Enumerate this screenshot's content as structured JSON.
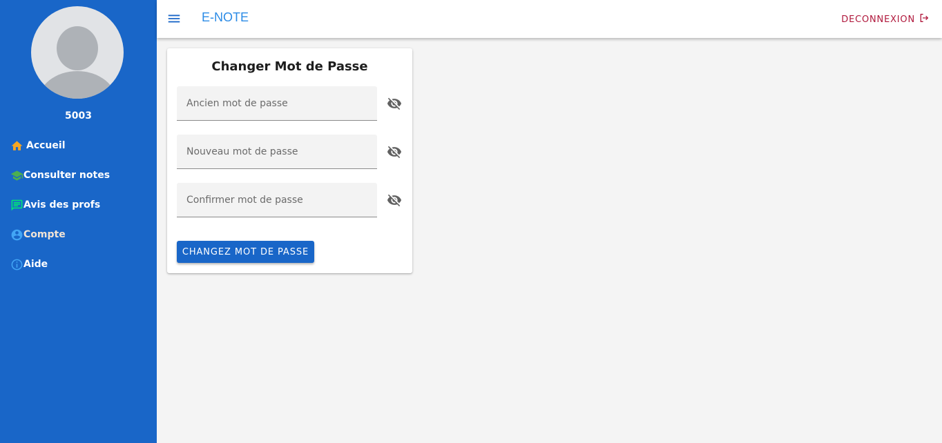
{
  "sidebar": {
    "user_id": "5003",
    "items": [
      {
        "label": "Accueil",
        "icon": "home-icon",
        "color": "#f5a623"
      },
      {
        "label": "Consulter notes",
        "icon": "graduation-cap-icon",
        "color": "#4caf50"
      },
      {
        "label": "Avis des profs",
        "icon": "feedback-icon",
        "color": "#00e676"
      },
      {
        "label": "Compte",
        "icon": "account-circle-icon",
        "color": "#42a5f5"
      },
      {
        "label": "Aide",
        "icon": "info-icon",
        "color": "#42a5f5"
      }
    ]
  },
  "topbar": {
    "title": "E-NOTE",
    "logout_label": "DECONNEXION"
  },
  "form": {
    "title": "Changer Mot de Passe",
    "fields": [
      {
        "placeholder": "Ancien mot de passe",
        "value": ""
      },
      {
        "placeholder": "Nouveau mot de passe",
        "value": ""
      },
      {
        "placeholder": "Confirmer mot de passe",
        "value": ""
      }
    ],
    "submit_label": "CHANGEZ MOT DE PASSE"
  },
  "colors": {
    "sidebar_bg": "#1966c8",
    "accent": "#2b8be6",
    "logout": "#b0183c",
    "button_bg": "#1966c8"
  }
}
